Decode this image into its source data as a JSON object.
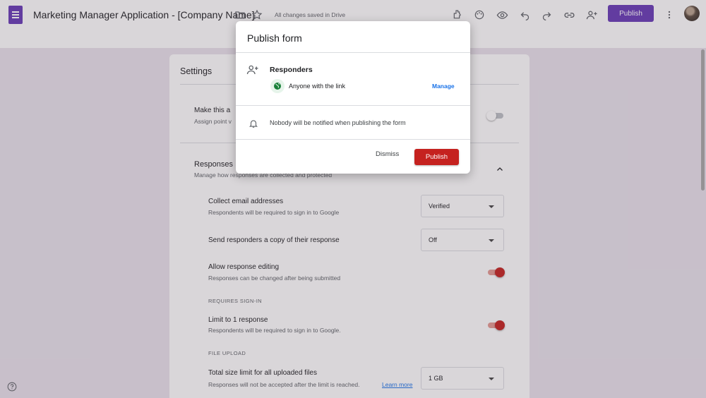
{
  "app": {
    "title": "Marketing Manager Application - [Company Name]",
    "saved_status": "All changes saved in Drive",
    "publish_label": "Publish",
    "icons": [
      "forms-logo-icon",
      "folder-icon",
      "star-icon",
      "addon-icon",
      "palette-icon",
      "preview-eye-icon",
      "undo-icon",
      "redo-icon",
      "link-icon",
      "add-collaborator-icon",
      "more-vert-icon"
    ]
  },
  "settings": {
    "title": "Settings",
    "quiz": {
      "title": "Make this a",
      "subtitle": "Assign point v"
    },
    "responses": {
      "title": "Responses",
      "subtitle": "Manage how responses are collected and protected",
      "collect_email": {
        "title": "Collect email addresses",
        "subtitle": "Respondents will be required to sign in to Google",
        "value": "Verified"
      },
      "send_copy": {
        "title": "Send responders a copy of their response",
        "value": "Off"
      },
      "allow_editing": {
        "title": "Allow response editing",
        "subtitle": "Responses can be changed after being submitted",
        "enabled": true
      },
      "requires_signin_label": "REQUIRES SIGN-IN",
      "limit_one": {
        "title": "Limit to 1 response",
        "subtitle": "Respondents will be required to sign in to Google.",
        "enabled": true
      },
      "file_upload_label": "FILE UPLOAD",
      "size_limit": {
        "title": "Total size limit for all uploaded files",
        "subtitle": "Responses will not be accepted after the limit is reached.",
        "learn_more": "Learn more",
        "value": "1 GB"
      }
    }
  },
  "dialog": {
    "title": "Publish form",
    "responders_label": "Responders",
    "access_text": "Anyone with the link",
    "manage_label": "Manage",
    "notify_text": "Nobody will be notified when publishing the form",
    "dismiss_label": "Dismiss",
    "publish_label": "Publish"
  },
  "colors": {
    "brand_purple": "#673ab7",
    "publish_red": "#c5221f",
    "link_blue": "#1a73e8",
    "globe_green": "#188038"
  }
}
